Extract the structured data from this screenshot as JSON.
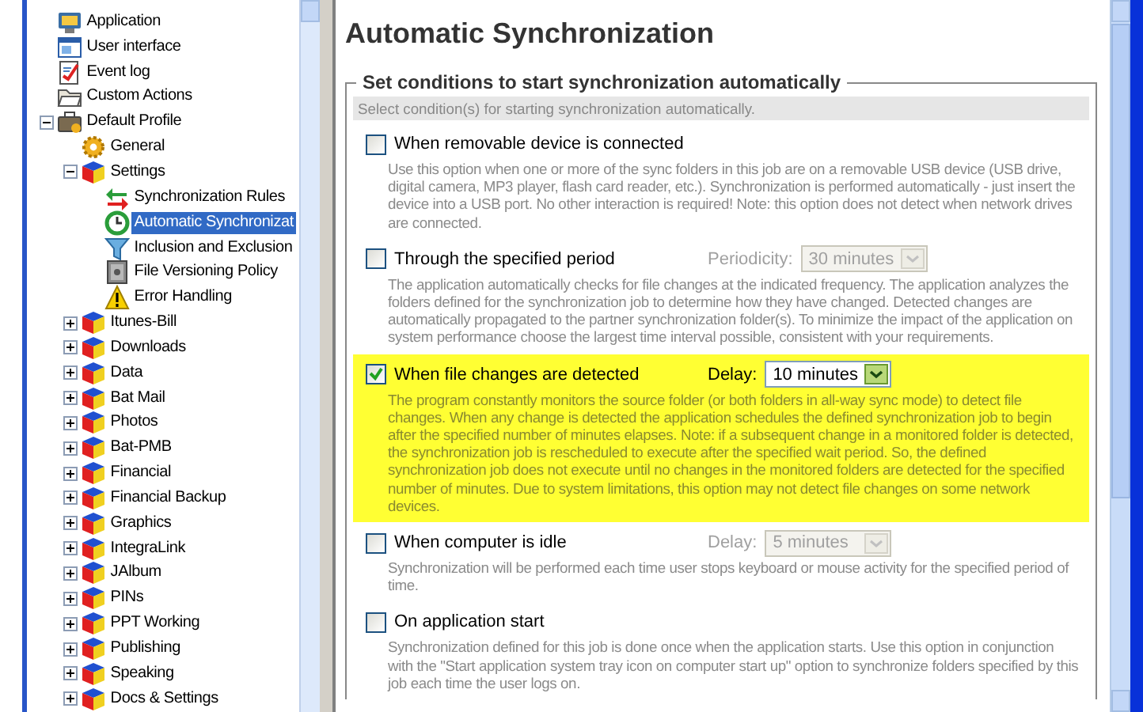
{
  "tree": {
    "items": [
      {
        "label": "Application",
        "kind": "app",
        "selected": false
      },
      {
        "label": "User interface",
        "kind": "ui",
        "selected": false
      },
      {
        "label": "Event log",
        "kind": "log",
        "selected": false
      },
      {
        "label": "Custom Actions",
        "kind": "actions",
        "selected": false
      },
      {
        "label": "Default Profile",
        "kind": "profile",
        "selected": false,
        "expanded": true,
        "children": [
          {
            "label": "General",
            "kind": "general",
            "selected": false
          },
          {
            "label": "Settings",
            "kind": "job",
            "selected": false,
            "expanded": true,
            "children": [
              {
                "label": "Synchronization Rules",
                "kind": "rules",
                "selected": false
              },
              {
                "label": "Automatic Synchronizat",
                "kind": "clock",
                "selected": true
              },
              {
                "label": "Inclusion and Exclusion",
                "kind": "filter",
                "selected": false
              },
              {
                "label": "File Versioning Policy",
                "kind": "safe",
                "selected": false
              },
              {
                "label": "Error Handling",
                "kind": "warning",
                "selected": false
              }
            ]
          },
          {
            "label": "Itunes-Bill",
            "kind": "job",
            "selected": false,
            "expanded": false
          },
          {
            "label": "Downloads",
            "kind": "job",
            "selected": false,
            "expanded": false
          },
          {
            "label": "Data",
            "kind": "job",
            "selected": false,
            "expanded": false
          },
          {
            "label": "Bat Mail",
            "kind": "job",
            "selected": false,
            "expanded": false
          },
          {
            "label": "Photos",
            "kind": "job",
            "selected": false,
            "expanded": false
          },
          {
            "label": "Bat-PMB",
            "kind": "job",
            "selected": false,
            "expanded": false
          },
          {
            "label": "Financial",
            "kind": "job",
            "selected": false,
            "expanded": false
          },
          {
            "label": "Financial Backup",
            "kind": "job",
            "selected": false,
            "expanded": false
          },
          {
            "label": "Graphics",
            "kind": "job",
            "selected": false,
            "expanded": false
          },
          {
            "label": "IntegraLink",
            "kind": "job",
            "selected": false,
            "expanded": false
          },
          {
            "label": "JAlbum",
            "kind": "job",
            "selected": false,
            "expanded": false
          },
          {
            "label": "PINs",
            "kind": "job",
            "selected": false,
            "expanded": false
          },
          {
            "label": "PPT Working",
            "kind": "job",
            "selected": false,
            "expanded": false
          },
          {
            "label": "Publishing",
            "kind": "job",
            "selected": false,
            "expanded": false
          },
          {
            "label": "Speaking",
            "kind": "job",
            "selected": false,
            "expanded": false
          },
          {
            "label": "Docs & Settings",
            "kind": "job",
            "selected": false,
            "expanded": false
          }
        ]
      }
    ]
  },
  "page": {
    "title": "Automatic Synchronization",
    "group": {
      "legend": "Set conditions to start synchronization automatically",
      "hint": "Select condition(s) for starting synchronization automatically.",
      "options": [
        {
          "label": "When removable device is connected",
          "checked": false,
          "description": "Use this option when one or more of the sync folders in this job are on a removable USB device (USB drive, digital camera, MP3 player, flash card reader, etc.). Synchronization is performed automatically - just insert the device into a USB port. No other interaction is required! Note: this option does not detect when network drives are connected."
        },
        {
          "label": "Through the specified period",
          "checked": false,
          "dropdown": {
            "label": "Periodicity:",
            "value": "30 minutes",
            "disabled": true
          },
          "description": "The application automatically checks for file changes at the indicated frequency. The application analyzes the folders defined for the synchronization job to determine how they have changed. Detected changes are automatically propagated to the partner synchronization folder(s). To minimize the impact of the application on system performance choose the largest time interval possible, consistent with your requirements."
        },
        {
          "label": "When file changes are detected",
          "checked": true,
          "dropdown": {
            "label": "Delay:",
            "value": "10 minutes",
            "disabled": false
          },
          "description": "The program constantly monitors the source folder (or both folders in all-way sync mode) to detect file changes. When any change is detected the application schedules the defined synchronization job to begin after the specified number of minutes elapses. Note: if a subsequent change in a monitored folder is detected, the synchronization job is rescheduled to execute after the specified wait period. So, the defined synchronization job does not execute until no changes in the monitored folders are detected for the specified number of minutes. Due to system limitations, this option may not detect file changes on some network devices."
        },
        {
          "label": "When computer is idle",
          "checked": false,
          "dropdown": {
            "label": "Delay:",
            "value": "5 minutes",
            "disabled": true
          },
          "description": "Synchronization will be performed each time user stops keyboard or mouse activity for the specified period of time."
        },
        {
          "label": "On application start",
          "checked": false,
          "description": "Synchronization defined for this job is done once when the application starts. Use this option in conjunction with the \"Start application system tray icon on computer start up\" option to synchronize folders specified by this job each time the user logs on."
        }
      ]
    }
  }
}
